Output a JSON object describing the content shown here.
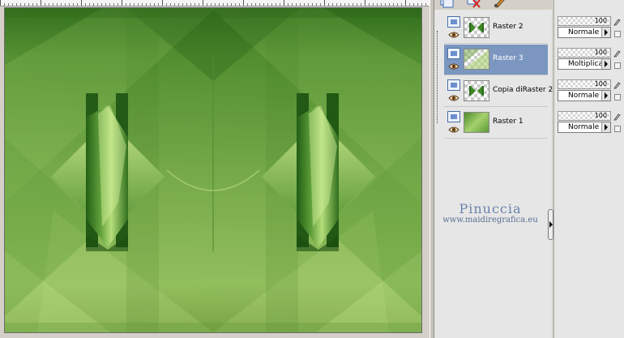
{
  "layers": [
    {
      "name": "Raster 2",
      "selected": false,
      "opacity": "100",
      "blend": "Normale",
      "thumb": "arrows"
    },
    {
      "name": "Raster 3",
      "selected": true,
      "opacity": "100",
      "blend": "Moltiplica",
      "thumb": "checker"
    },
    {
      "name": "Copia diRaster 2",
      "selected": false,
      "opacity": "100",
      "blend": "Normale",
      "thumb": "arrows"
    },
    {
      "name": "Raster 1",
      "selected": false,
      "opacity": "100",
      "blend": "Normale",
      "thumb": "green"
    }
  ],
  "watermark": {
    "name": "Pinuccia",
    "url": "www.maidiregrafica.eu"
  },
  "colors": {
    "selection": "#7b97c0",
    "canvas_dark": "#2f6e1c",
    "canvas_light": "#a8d070"
  },
  "icons": {
    "toolbar": [
      "new-layer-icon",
      "delete-layer-icon",
      "brush-icon"
    ],
    "row": [
      "layer-visibility-icon",
      "eye-icon",
      "lock-icon"
    ]
  }
}
